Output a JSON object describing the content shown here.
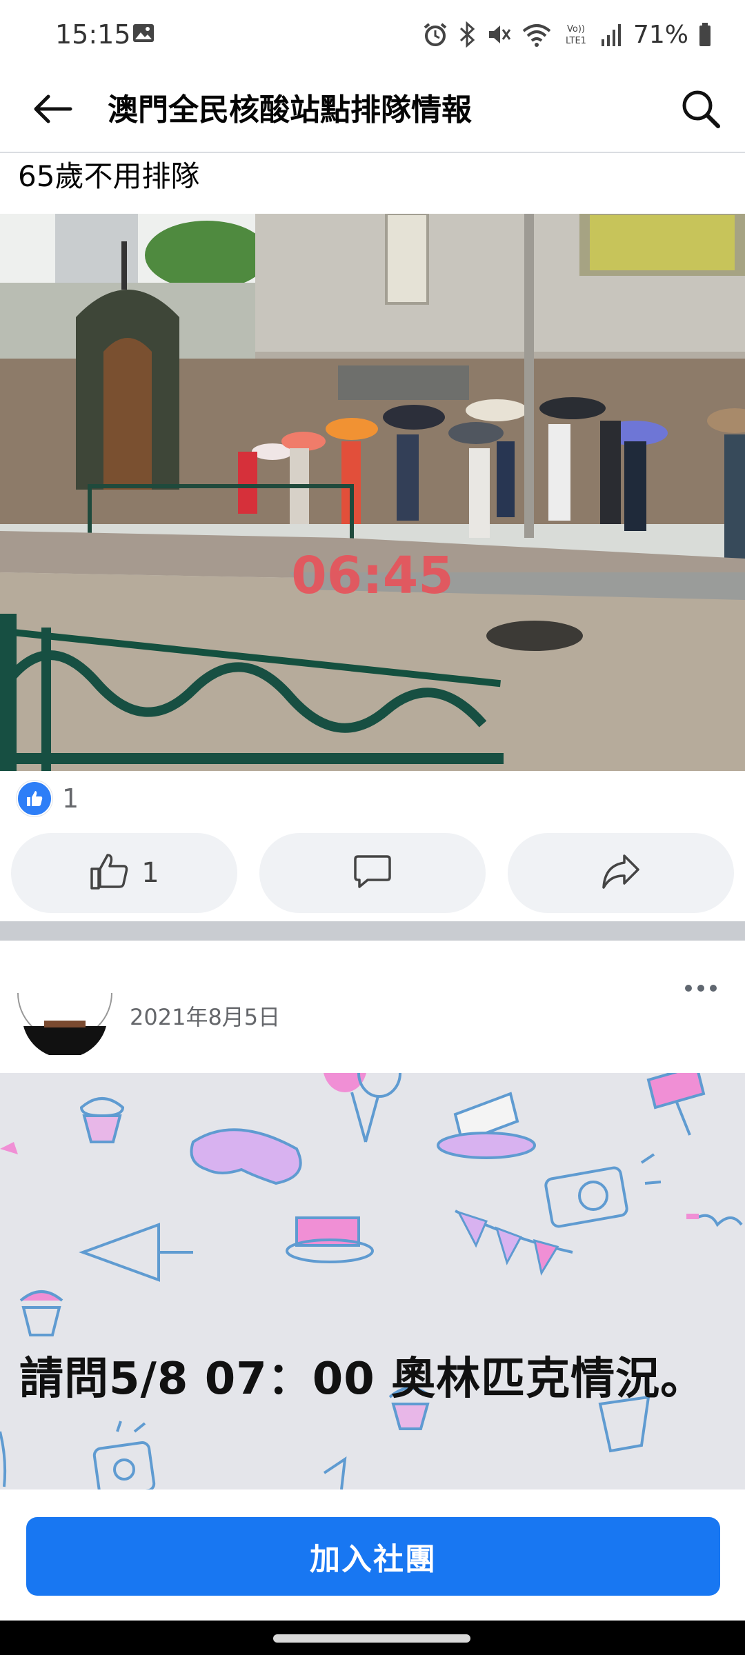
{
  "status_bar": {
    "time": "15:15",
    "battery": "71%",
    "icons": [
      "gallery-icon",
      "alarm-icon",
      "bluetooth-icon",
      "mute-icon",
      "wifi-icon",
      "volte-icon",
      "signal-icon",
      "battery-icon"
    ]
  },
  "app_bar": {
    "title": "澳門全民核酸站點排隊情報",
    "icons": [
      "back-arrow-icon",
      "search-icon"
    ]
  },
  "post1": {
    "text": "65歲不用排隊",
    "photo_overlay_time": "06:45",
    "reaction_count": "1",
    "like_count": "1",
    "icons": [
      "like-reaction-icon",
      "thumbs-up-icon",
      "comment-icon",
      "share-icon"
    ]
  },
  "post2": {
    "date": "2021年8月5日",
    "text": "請問5/8  07：00 奧林匹克情況。",
    "icons": [
      "more-options-icon"
    ]
  },
  "join": {
    "label": "加入社團"
  },
  "colors": {
    "brand_blue": "#1877f2",
    "like_blue": "#2d7ef7",
    "action_bg": "#f0f2f5",
    "card_bg": "#e4e5ea",
    "overlay_red": "#e8525a"
  }
}
